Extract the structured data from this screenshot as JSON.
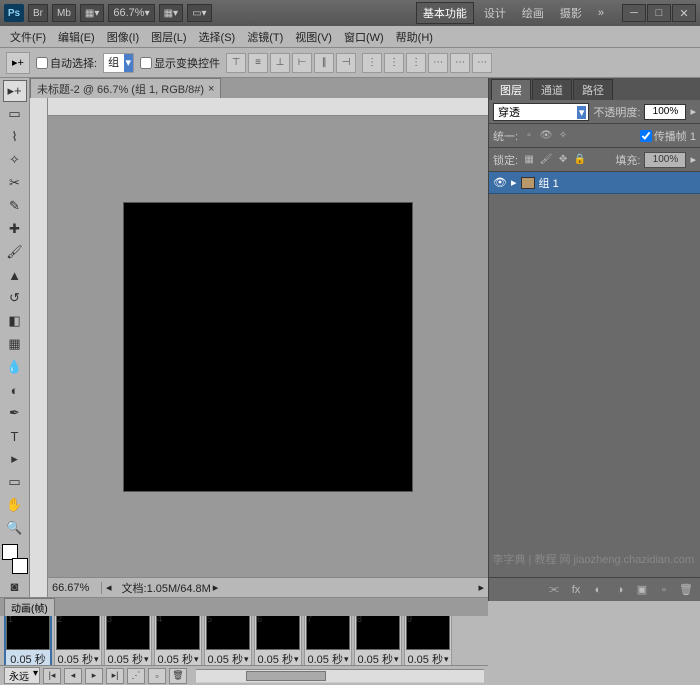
{
  "titlebar": {
    "logo": "Ps",
    "br": "Br",
    "mb": "Mb",
    "zoom_display": "66.7%",
    "workspace_selected": "基本功能",
    "workspaces": [
      "设计",
      "绘画",
      "摄影"
    ],
    "expand": "»"
  },
  "menu": [
    "文件(F)",
    "编辑(E)",
    "图像(I)",
    "图层(L)",
    "选择(S)",
    "滤镜(T)",
    "视图(V)",
    "窗口(W)",
    "帮助(H)"
  ],
  "options": {
    "auto_select_label": "自动选择:",
    "auto_select_value": "组",
    "show_transform_label": "显示变换控件"
  },
  "doc_tab": "未标题-2 @ 66.7% (组 1, RGB/8#)",
  "status": {
    "zoom": "66.67%",
    "info": "文档:1.05M/64.8M"
  },
  "animation": {
    "tab": "动画(帧)",
    "frames": [
      {
        "n": "1",
        "t": "0.05 秒"
      },
      {
        "n": "2",
        "t": "0.05 秒"
      },
      {
        "n": "3",
        "t": "0.05 秒"
      },
      {
        "n": "4",
        "t": "0.05 秒"
      },
      {
        "n": "5",
        "t": "0.05 秒"
      },
      {
        "n": "6",
        "t": "0.05 秒"
      },
      {
        "n": "7",
        "t": "0.05 秒"
      },
      {
        "n": "8",
        "t": "0.05 秒"
      },
      {
        "n": "9",
        "t": "0.05 秒"
      }
    ],
    "loop": "永远"
  },
  "panels": {
    "tabs": [
      "图层",
      "通道",
      "路径"
    ],
    "blend_mode": "穿透",
    "opacity_label": "不透明度:",
    "opacity_value": "100%",
    "unify_label": "统一:",
    "propagate_label": "传播帧 1",
    "lock_label": "锁定:",
    "fill_label": "填充:",
    "fill_value": "100%",
    "layer_name": "组 1"
  },
  "watermark": "李字典 | 教程 网 jiaozheng.chazidian.com"
}
